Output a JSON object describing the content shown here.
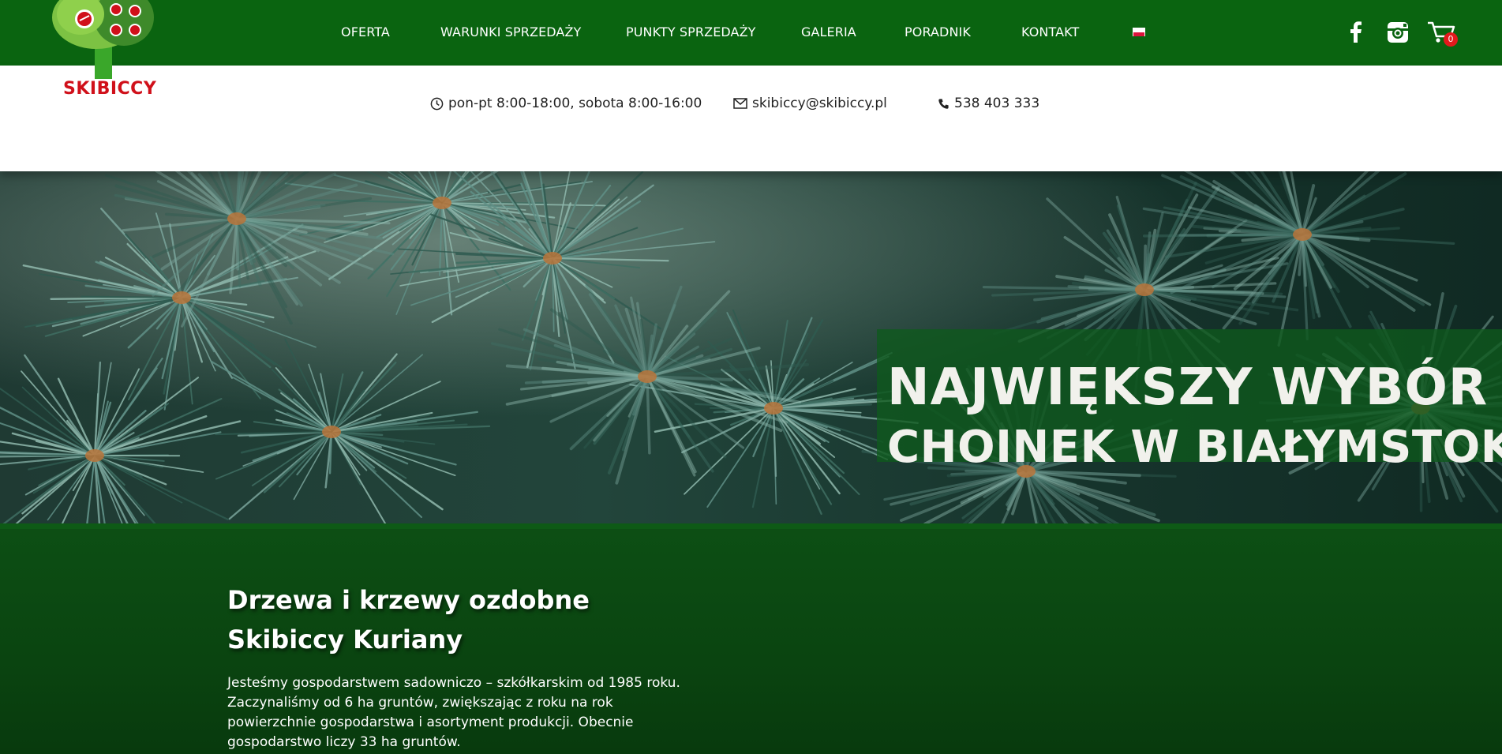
{
  "brand": {
    "name": "SKIBICCY",
    "colors": {
      "primary_green": "#0a6410",
      "brand_red": "#d0101a",
      "banner_green": "#0e5a1c"
    }
  },
  "nav": {
    "items": [
      {
        "label": "OFERTA"
      },
      {
        "label": "WARUNKI SPRZEDAŻY"
      },
      {
        "label": "PUNKTY SPRZEDAŻY"
      },
      {
        "label": "GALERIA"
      },
      {
        "label": "PORADNIK"
      },
      {
        "label": "KONTAKT"
      }
    ],
    "language_flag": "flag-pl-icon"
  },
  "social": {
    "facebook_icon": "facebook-icon",
    "instagram_icon": "instagram-icon",
    "cart_icon": "cart-icon",
    "cart_count": "0"
  },
  "info": {
    "hours": "pon-pt 8:00-18:00, sobota 8:00-16:00",
    "email": "skibiccy@skibiccy.pl",
    "phone": "538 403 333"
  },
  "hero": {
    "line1": "NAJWIĘKSZY WYBÓR",
    "line2": "CHOINEK W BIAŁYMSTOKU"
  },
  "intro": {
    "heading": "Drzewa i krzewy ozdobne Skibiccy Kuriany",
    "paragraph": "Jesteśmy gospodarstwem sadowniczo – szkółkarskim od 1985 roku. Zaczynaliśmy od 6 ha gruntów, zwiększając z roku na rok powierzchnie gospodarstwa i asortyment produkcji. Obecnie gospodarstwo liczy 33 ha gruntów."
  }
}
